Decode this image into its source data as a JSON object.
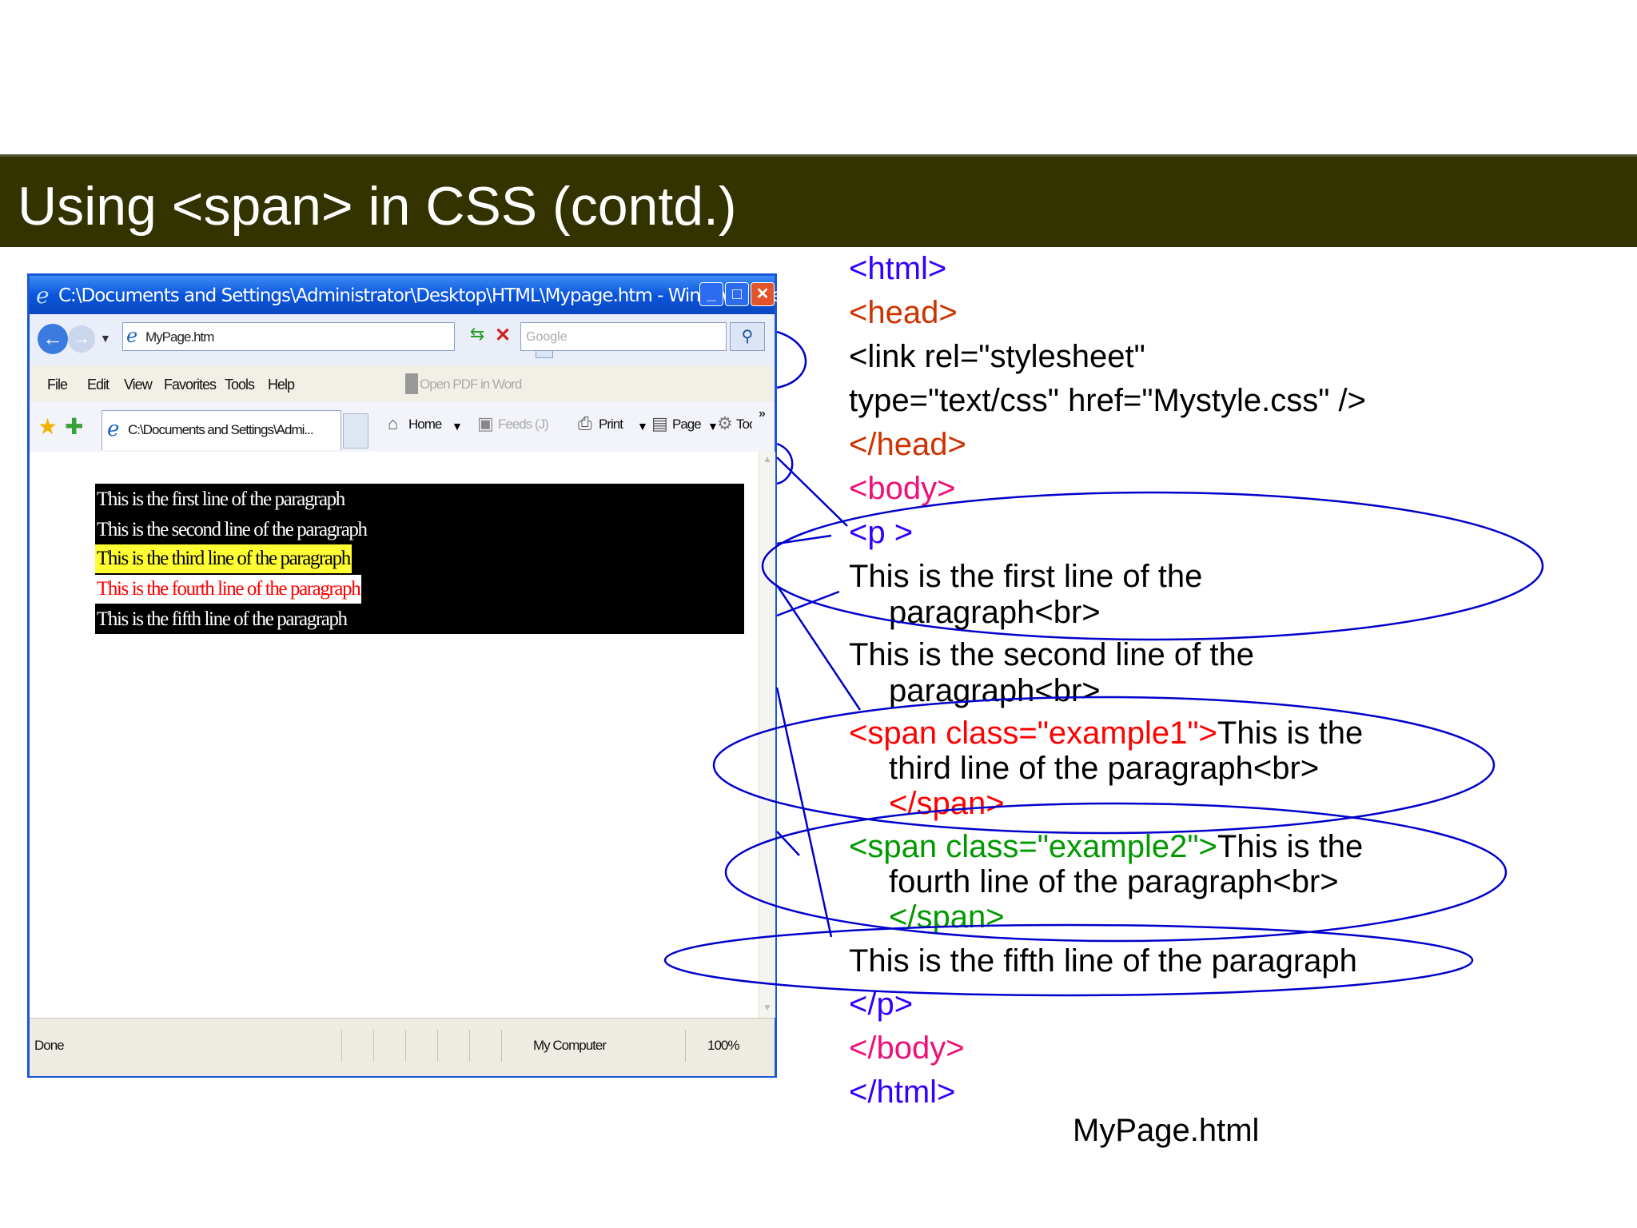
{
  "slide": {
    "title": "Using <span> in CSS (contd.)",
    "caption": "MyPage.html"
  },
  "browser": {
    "window_title": "C:\\Documents and Settings\\Administrator\\Desktop\\HTML\\Mypage.htm - Windows Internet Explorer",
    "address": "MyPage.htm",
    "search_placeholder": "Google",
    "menu": [
      "File",
      "Edit",
      "View",
      "Favorites",
      "Tools",
      "Help"
    ],
    "open_pdf": "Open PDF in Word",
    "tab_title": "C:\\Documents and Settings\\Admi...",
    "commands": {
      "home": "Home",
      "feeds": "Feeds (J)",
      "print": "Print",
      "page": "Page",
      "tools": "Tools"
    },
    "status": {
      "text": "Done",
      "zone": "My Computer",
      "zoom": "100%"
    },
    "content_lines": [
      "This is the first line of the paragraph",
      "This is the second line of the paragraph",
      "This is the third line of the paragraph",
      "This is the fourth line of the paragraph",
      "This is the fifth line of the paragraph"
    ]
  },
  "code": {
    "html_open": "<html>",
    "head_open": "<head>",
    "link_1": "<link rel=\"stylesheet\"",
    "link_2": "type=\"text/css\" href=\"Mystyle.css\" />",
    "head_close": "</head>",
    "body_open": "<body>",
    "p_open": "<p >",
    "line1_a": "This is the first line of the",
    "line1_b": "paragraph<br>",
    "line2_a": "This is the second line of the",
    "line2_b": "paragraph<br>",
    "span1_tag": "<span class=\"example1\">",
    "span1_text": "This is the",
    "span1_b": "third line of the paragraph<br>",
    "span1_close": "</span>",
    "span2_tag": "<span class=\"example2\">",
    "span2_text": "This is the",
    "span2_b": "fourth line of the paragraph<br>",
    "span2_close": "</span>",
    "line5": "This is the fifth line of the paragraph",
    "p_close": "</p>",
    "body_close": "</body>",
    "html_close": "</html>"
  },
  "colors": {
    "title_bar": "#333300",
    "tag_blue": "#3300ff",
    "tag_brown": "#cc3300",
    "tag_pink": "#ee1177",
    "span1_red": "#ff0000",
    "span2_green": "#009900",
    "annotation": "#0000cc"
  }
}
